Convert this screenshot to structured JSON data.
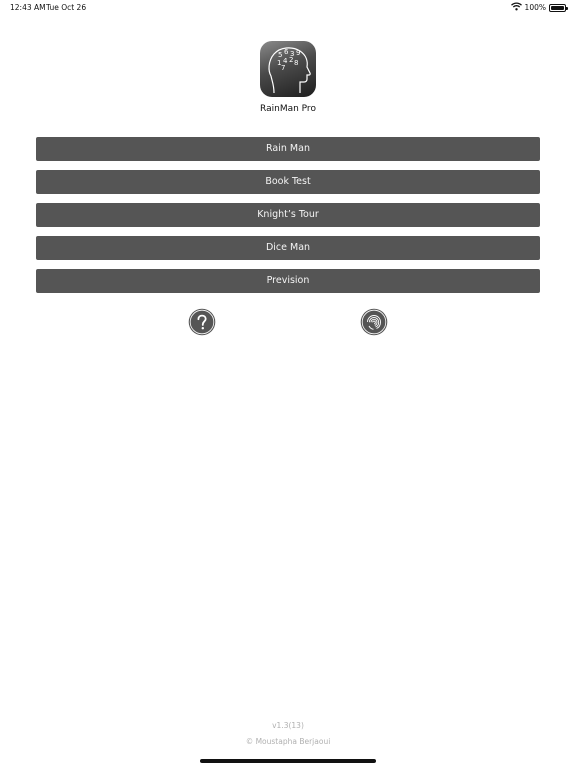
{
  "status_bar": {
    "time": "12:43 AM",
    "date": "Tue Oct 26",
    "battery": "100%",
    "icons": [
      "wifi-icon",
      "battery-icon"
    ]
  },
  "app": {
    "name": "RainMan Pro",
    "icon": "head-with-numbers-icon"
  },
  "menu": {
    "items": [
      {
        "label": "Rain Man"
      },
      {
        "label": "Book Test"
      },
      {
        "label": "Knight’s Tour"
      },
      {
        "label": "Dice Man"
      },
      {
        "label": "Prevision"
      }
    ]
  },
  "actions": {
    "help_icon": "question-mark-icon",
    "settings_icon": "fingerprint-icon"
  },
  "footer": {
    "version": "v1.3(13)",
    "copyright": "© Moustapha Berjaoui"
  },
  "colors": {
    "button_bg": "#555555",
    "button_text": "#f5f5f5",
    "footer_text": "#b0b0b0"
  }
}
